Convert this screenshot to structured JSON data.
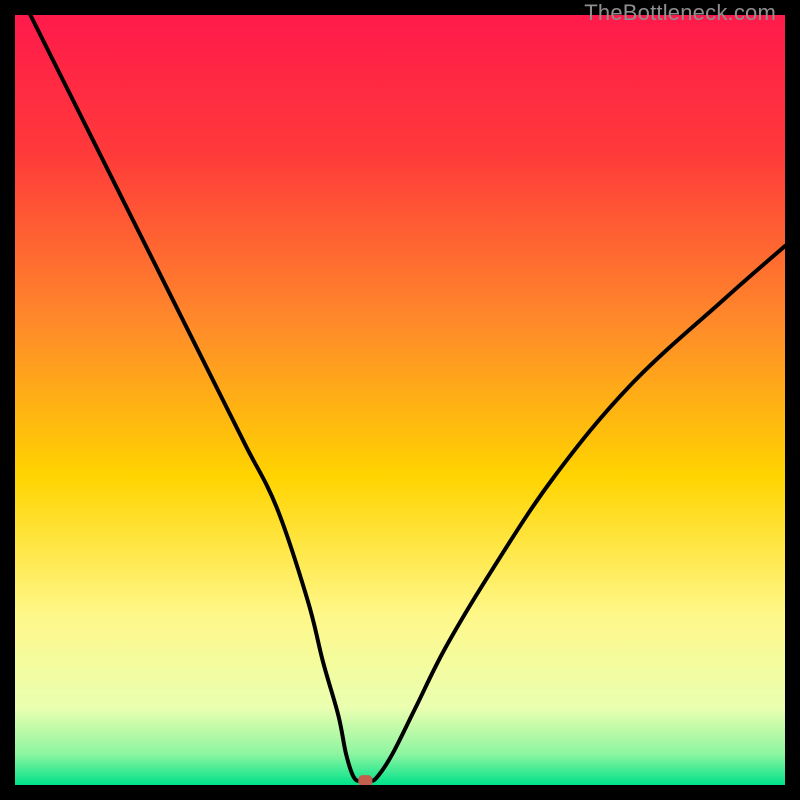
{
  "watermark": "TheBottleneck.com",
  "chart_data": {
    "type": "line",
    "title": "",
    "xlabel": "",
    "ylabel": "",
    "xlim": [
      0,
      100
    ],
    "ylim": [
      0,
      100
    ],
    "gradient_stops": [
      {
        "offset": 0,
        "color": "#ff1a4b"
      },
      {
        "offset": 18,
        "color": "#ff3a3a"
      },
      {
        "offset": 40,
        "color": "#ff8a2a"
      },
      {
        "offset": 60,
        "color": "#ffd400"
      },
      {
        "offset": 78,
        "color": "#fff88a"
      },
      {
        "offset": 90,
        "color": "#eaffb0"
      },
      {
        "offset": 96,
        "color": "#8cf5a0"
      },
      {
        "offset": 100,
        "color": "#00e28a"
      }
    ],
    "series": [
      {
        "name": "bottleneck-curve",
        "x": [
          2,
          6,
          10,
          14,
          18,
          22,
          26,
          30,
          34,
          38,
          40,
          42,
          43,
          44,
          45,
          46,
          47,
          49,
          52,
          56,
          62,
          70,
          80,
          92,
          100
        ],
        "y": [
          100,
          92,
          84,
          76,
          68,
          60,
          52,
          44,
          36,
          24,
          16,
          9,
          4,
          1,
          0.5,
          0.5,
          1,
          4,
          10,
          18,
          28,
          40,
          52,
          63,
          70
        ]
      }
    ],
    "marker": {
      "x": 45.5,
      "y": 0.5,
      "color": "#c1604f"
    }
  }
}
